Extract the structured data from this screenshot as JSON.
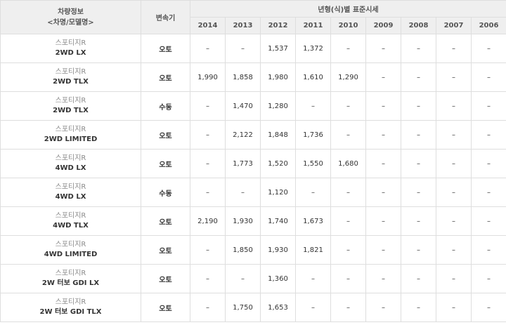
{
  "header": {
    "vehicle_info": "차량정보",
    "vehicle_sub": "<차명/모델명>",
    "transmission": "변속기",
    "price_title": "년형(식)별 표준시세",
    "years": [
      "2014",
      "2013",
      "2012",
      "2011",
      "2010",
      "2009",
      "2008",
      "2007",
      "2006"
    ]
  },
  "rows": [
    {
      "maker": "스포티지R",
      "model": "2WD LX",
      "trans": "오토",
      "prices": [
        "–",
        "–",
        "1,537",
        "1,372",
        "–",
        "–",
        "–",
        "–",
        "–"
      ]
    },
    {
      "maker": "스포티지R",
      "model": "2WD TLX",
      "trans": "오토",
      "prices": [
        "1,990",
        "1,858",
        "1,980",
        "1,610",
        "1,290",
        "–",
        "–",
        "–",
        "–"
      ]
    },
    {
      "maker": "스포티지R",
      "model": "2WD TLX",
      "trans": "수동",
      "prices": [
        "–",
        "1,470",
        "1,280",
        "–",
        "–",
        "–",
        "–",
        "–",
        "–"
      ]
    },
    {
      "maker": "스포티지R",
      "model": "2WD LIMITED",
      "trans": "오토",
      "prices": [
        "–",
        "2,122",
        "1,848",
        "1,736",
        "–",
        "–",
        "–",
        "–",
        "–"
      ]
    },
    {
      "maker": "스포티지R",
      "model": "4WD LX",
      "trans": "오토",
      "prices": [
        "–",
        "1,773",
        "1,520",
        "1,550",
        "1,680",
        "–",
        "–",
        "–",
        "–"
      ]
    },
    {
      "maker": "스포티지R",
      "model": "4WD LX",
      "trans": "수동",
      "prices": [
        "–",
        "–",
        "1,120",
        "–",
        "–",
        "–",
        "–",
        "–",
        "–"
      ]
    },
    {
      "maker": "스포티지R",
      "model": "4WD TLX",
      "trans": "오토",
      "prices": [
        "2,190",
        "1,930",
        "1,740",
        "1,673",
        "–",
        "–",
        "–",
        "–",
        "–"
      ]
    },
    {
      "maker": "스포티지R",
      "model": "4WD LIMITED",
      "trans": "오토",
      "prices": [
        "–",
        "1,850",
        "1,930",
        "1,821",
        "–",
        "–",
        "–",
        "–",
        "–"
      ]
    },
    {
      "maker": "스포티지R",
      "model": "2W 터보 GDI LX",
      "trans": "오토",
      "prices": [
        "–",
        "–",
        "1,360",
        "–",
        "–",
        "–",
        "–",
        "–",
        "–"
      ]
    },
    {
      "maker": "스포티지R",
      "model": "2W 터보 GDI TLX",
      "trans": "오토",
      "prices": [
        "–",
        "1,750",
        "1,653",
        "–",
        "–",
        "–",
        "–",
        "–",
        "–"
      ]
    }
  ]
}
